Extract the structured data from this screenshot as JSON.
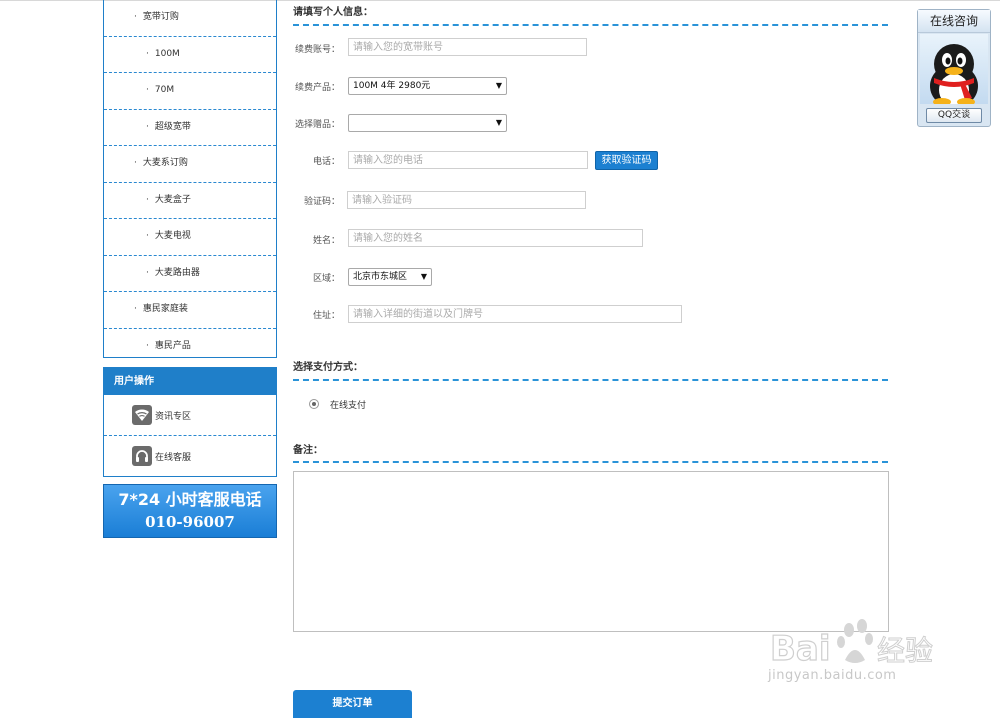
{
  "sidebar": {
    "menu": [
      {
        "label": "宽带订购",
        "level": 1
      },
      {
        "label": "100M",
        "level": 2
      },
      {
        "label": "70M",
        "level": 2
      },
      {
        "label": "超级宽带",
        "level": 2
      },
      {
        "label": "大麦系订购",
        "level": 1
      },
      {
        "label": "大麦盒子",
        "level": 2
      },
      {
        "label": "大麦电视",
        "level": 2
      },
      {
        "label": "大麦路由器",
        "level": 2
      },
      {
        "label": "惠民家庭装",
        "level": 1
      },
      {
        "label": "惠民产品",
        "level": 2
      }
    ],
    "bullet": "·",
    "ops_title": "用户操作",
    "ops": [
      {
        "label": "资讯专区",
        "icon": "wifi-icon"
      },
      {
        "label": "在线客服",
        "icon": "headset-icon"
      }
    ],
    "hotline_line1": "7*24 小时客服电话",
    "hotline_line2": "010-96007"
  },
  "form": {
    "section_title": "请填写个人信息：",
    "account": {
      "label": "续费账号：",
      "placeholder": "请输入您的宽带账号"
    },
    "product": {
      "label": "续费产品：",
      "value": "100M 4年 2980元"
    },
    "gift": {
      "label": "选择赠品：",
      "value": ""
    },
    "phone": {
      "label": "电话：",
      "placeholder": "请输入您的电话",
      "button": "获取验证码"
    },
    "code": {
      "label": "验证码：",
      "placeholder": "请输入验证码"
    },
    "name": {
      "label": "姓名：",
      "placeholder": "请输入您的姓名"
    },
    "region": {
      "label": "区域：",
      "value": "北京市东城区"
    },
    "address": {
      "label": "住址：",
      "placeholder": "请输入详细的街道以及门牌号"
    }
  },
  "payment": {
    "section_title": "选择支付方式：",
    "option": "在线支付"
  },
  "remark": {
    "section_title": "备注："
  },
  "submit_label": "提交订单",
  "qq_widget": {
    "title": "在线咨询",
    "button": "QQ交谈"
  },
  "watermark": {
    "brand": "Bai 经验",
    "url": "jingyan.baidu.com"
  },
  "colors": {
    "primary": "#1f7fc9",
    "dash": "#2a93d8"
  }
}
